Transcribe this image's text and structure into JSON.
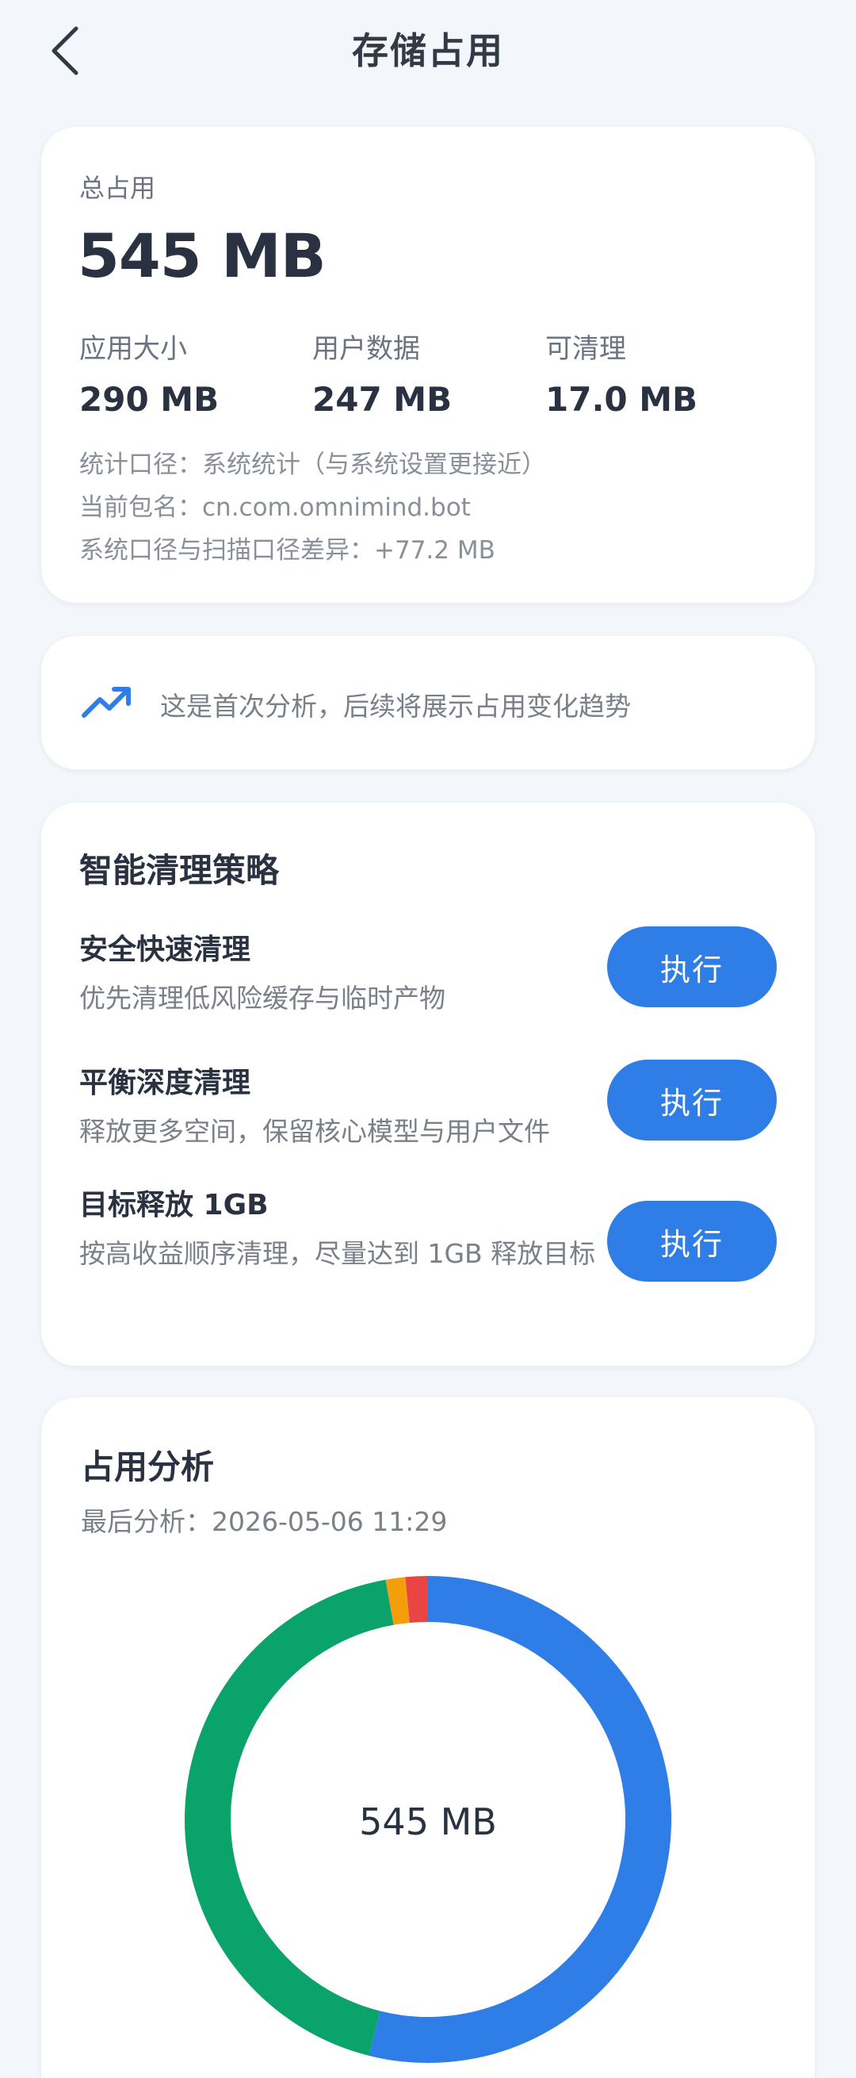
{
  "header": {
    "title": "存储占用",
    "back_icon": "chevron-left-icon"
  },
  "summary": {
    "total_label": "总占用",
    "total_value": "545 MB",
    "stats": [
      {
        "label": "应用大小",
        "value": "290 MB"
      },
      {
        "label": "用户数据",
        "value": "247 MB"
      },
      {
        "label": "可清理",
        "value": "17.0 MB"
      }
    ],
    "info_lines": [
      "统计口径：系统统计（与系统设置更接近）",
      "当前包名：cn.com.omnimind.bot",
      "系统口径与扫描口径差异：+77.2 MB"
    ]
  },
  "trend": {
    "icon": "trending-up-icon",
    "text": "这是首次分析，后续将展示占用变化趋势"
  },
  "strategy": {
    "title": "智能清理策略",
    "items": [
      {
        "name": "安全快速清理",
        "desc": "优先清理低风险缓存与临时产物",
        "button": "执行"
      },
      {
        "name": "平衡深度清理",
        "desc": "释放更多空间，保留核心模型与用户文件",
        "button": "执行"
      },
      {
        "name": "目标释放 1GB",
        "desc": "按高收益顺序清理，尽量达到 1GB 释放目标",
        "button": "执行"
      }
    ]
  },
  "analysis": {
    "title": "占用分析",
    "last_time": "最后分析：2026-05-06 11:29",
    "center_value": "545 MB"
  },
  "chart_data": {
    "type": "pie",
    "donut": true,
    "values": [
      290,
      233,
      7,
      8
    ],
    "colors": [
      "#2f7de6",
      "#0aa36b",
      "#f59e0b",
      "#e94545"
    ],
    "title": "",
    "legend": "none"
  }
}
